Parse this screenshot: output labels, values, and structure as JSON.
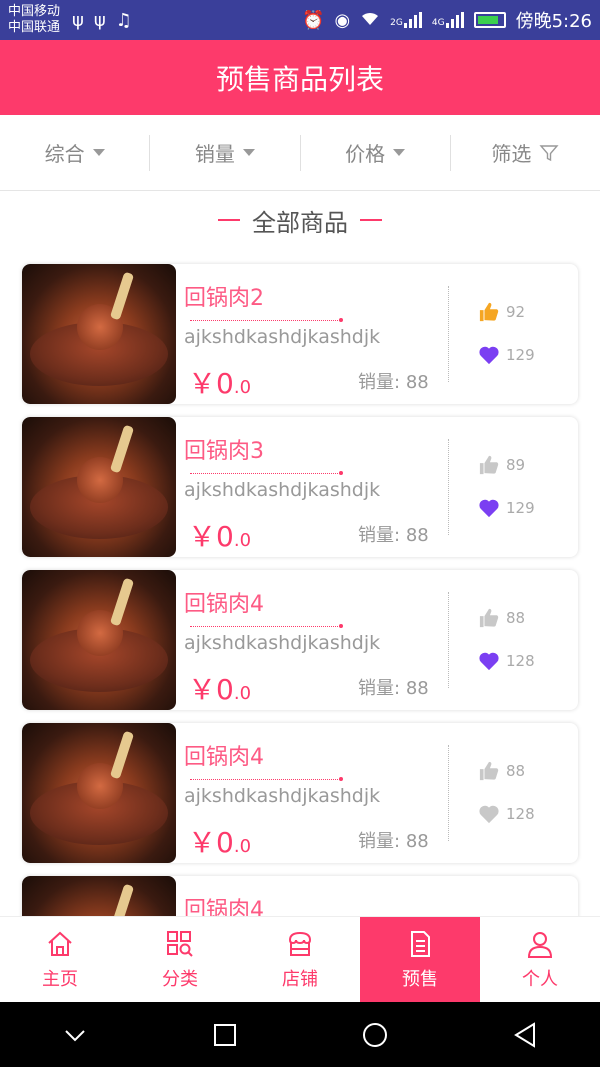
{
  "status_bar": {
    "carrier1": "中国移动",
    "carrier2": "中国联通",
    "signal1": "2G",
    "signal2": "4G",
    "time": "傍晚5:26"
  },
  "header": {
    "title": "预售商品列表"
  },
  "filters": [
    {
      "label": "综合",
      "icon": "caret-down-icon"
    },
    {
      "label": "销量",
      "icon": "caret-down-icon"
    },
    {
      "label": "价格",
      "icon": "caret-down-icon"
    },
    {
      "label": "筛选",
      "icon": "filter-icon"
    }
  ],
  "section_title": "全部商品",
  "products": [
    {
      "title": "回锅肉2",
      "desc": "ajkshdkashdjkashdjk",
      "price_symbol": "￥",
      "price_main": "0",
      "price_decimal": ".0",
      "sales_label": "销量:",
      "sales": "88",
      "likes": "92",
      "favs": "129",
      "liked": true,
      "faved": true
    },
    {
      "title": "回锅肉3",
      "desc": "ajkshdkashdjkashdjk",
      "price_symbol": "￥",
      "price_main": "0",
      "price_decimal": ".0",
      "sales_label": "销量:",
      "sales": "88",
      "likes": "89",
      "favs": "129",
      "liked": false,
      "faved": true
    },
    {
      "title": "回锅肉4",
      "desc": "ajkshdkashdjkashdjk",
      "price_symbol": "￥",
      "price_main": "0",
      "price_decimal": ".0",
      "sales_label": "销量:",
      "sales": "88",
      "likes": "88",
      "favs": "128",
      "liked": false,
      "faved": true
    },
    {
      "title": "回锅肉4",
      "desc": "ajkshdkashdjkashdjk",
      "price_symbol": "￥",
      "price_main": "0",
      "price_decimal": ".0",
      "sales_label": "销量:",
      "sales": "88",
      "likes": "88",
      "favs": "128",
      "liked": false,
      "faved": false
    },
    {
      "title": "回锅肉4"
    }
  ],
  "tabs": [
    {
      "label": "主页",
      "icon": "home-icon",
      "active": false
    },
    {
      "label": "分类",
      "icon": "category-search-icon",
      "active": false
    },
    {
      "label": "店铺",
      "icon": "store-icon",
      "active": false
    },
    {
      "label": "预售",
      "icon": "document-icon",
      "active": true
    },
    {
      "label": "个人",
      "icon": "person-icon",
      "active": false
    }
  ],
  "colors": {
    "accent": "#fd3a6b",
    "status_bar": "#3a3f9a",
    "like_active": "#f5a623",
    "fav_active": "#7b3ff2",
    "inactive_icon": "#c8c8c8"
  }
}
